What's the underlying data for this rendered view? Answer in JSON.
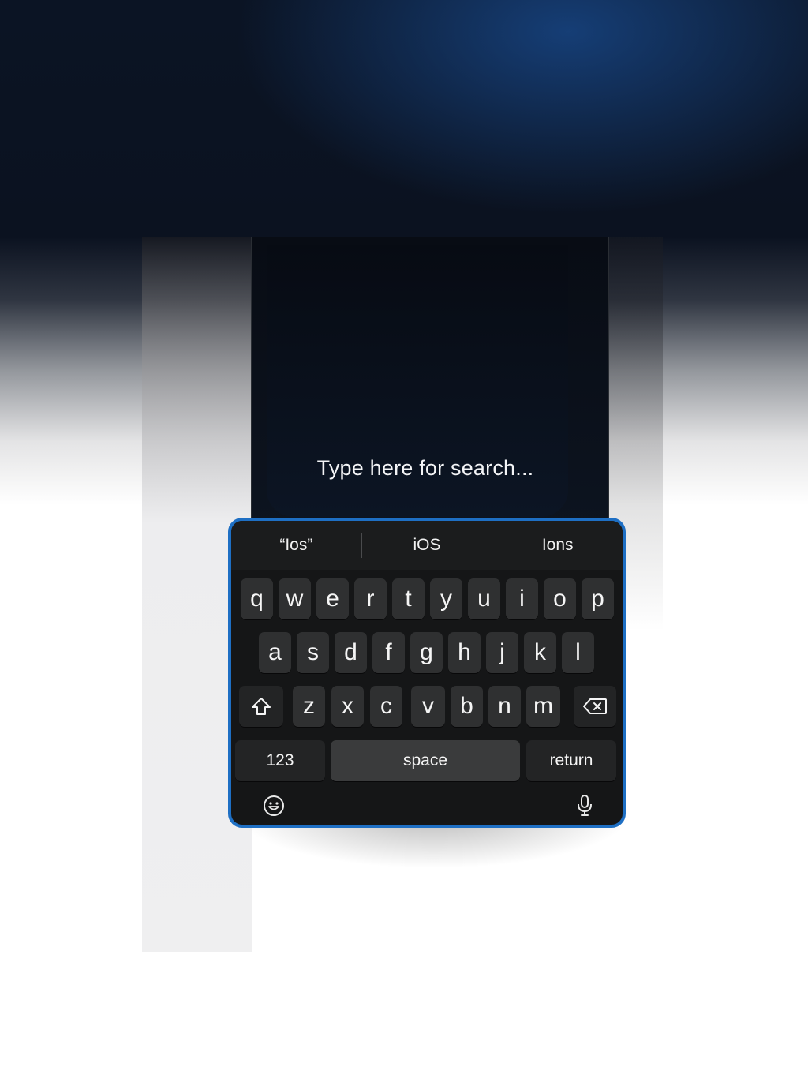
{
  "search": {
    "placeholder_text": "Type here for search..."
  },
  "suggestions": [
    "“Ios”",
    "iOS",
    "Ions"
  ],
  "rows": {
    "row1": [
      "q",
      "w",
      "e",
      "r",
      "t",
      "y",
      "u",
      "i",
      "o",
      "p"
    ],
    "row2": [
      "a",
      "s",
      "d",
      "f",
      "g",
      "h",
      "j",
      "k",
      "l"
    ],
    "row3": [
      "z",
      "x",
      "c",
      "v",
      "b",
      "n",
      "m"
    ]
  },
  "bottom_row": {
    "numbers_label": "123",
    "space_label": "space",
    "return_label": "return"
  },
  "icons": {
    "shift": "shift-icon",
    "delete": "backspace-icon",
    "emoji": "emoji-icon",
    "mic": "microphone-icon"
  },
  "colors": {
    "keyboard_border": "#1e6fc4",
    "keyboard_bg": "#151617",
    "key_bg": "#2f3031"
  }
}
